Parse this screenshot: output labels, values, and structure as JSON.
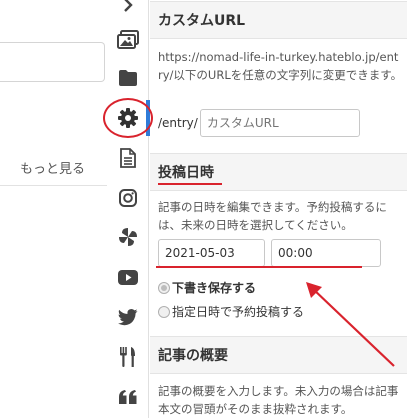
{
  "left_panel": {
    "more_link": "もっと見る"
  },
  "icons": [
    {
      "name": "chevron-right-icon"
    },
    {
      "name": "image-icon"
    },
    {
      "name": "folder-icon"
    },
    {
      "name": "gear-icon"
    },
    {
      "name": "document-icon"
    },
    {
      "name": "instagram-icon"
    },
    {
      "name": "google-photos-icon"
    },
    {
      "name": "youtube-icon"
    },
    {
      "name": "twitter-icon"
    },
    {
      "name": "restaurant-icon"
    },
    {
      "name": "quote-icon"
    }
  ],
  "custom_url": {
    "title": "カスタムURL",
    "description": "https://nomad-life-in-turkey.hateblo.jp/entry/以下のURLを任意の文字列に変更できます。",
    "prefix": "/entry/",
    "placeholder": "カスタムURL"
  },
  "post_date": {
    "title": "投稿日時",
    "description": "記事の日時を編集できます。予約投稿するには、未来の日時を選択してください。",
    "date_value": "2021-05-03",
    "time_value": "00:00",
    "option_draft": "下書き保存する",
    "option_scheduled": "指定日時で予約投稿する"
  },
  "summary": {
    "title": "記事の概要",
    "description": "記事の概要を入力します。未入力の場合は記事本文の冒頭がそのまま抜粋されます。"
  },
  "colors": {
    "accent": "#2f7bd8",
    "annotation": "#d9232d",
    "icon": "#444444"
  }
}
